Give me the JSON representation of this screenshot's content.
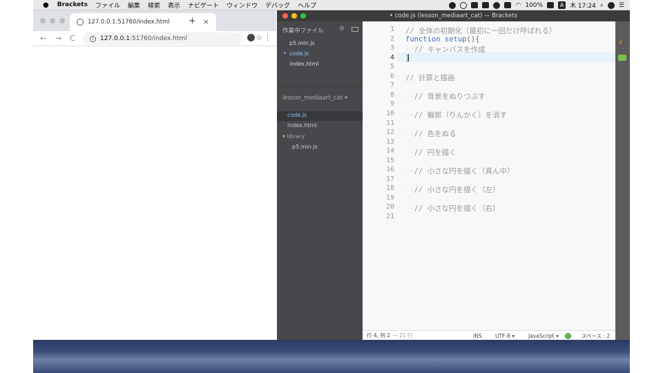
{
  "menubar": {
    "apple": "",
    "app_name": "Brackets",
    "items": [
      "ファイル",
      "編集",
      "検索",
      "表示",
      "ナビゲート",
      "ウィンドウ",
      "デバッグ",
      "ヘルプ"
    ],
    "battery": "100%",
    "clock": "木 17:24",
    "input_method": "A"
  },
  "browser": {
    "tab_title": "127.0.0.1:51760/index.html",
    "tab_close": "×",
    "new_tab": "+",
    "url": "127.0.0.1:51760/index.html",
    "url_host": "127.0.0.1",
    "url_rest": ":51760/index.html",
    "back": "←",
    "forward": "→",
    "reload": "C",
    "star": "☆",
    "kebab": "⋮"
  },
  "brackets": {
    "window_title": "• code.js (lesson_mediaart_cat) — Brackets",
    "working_files_header": "作業中ファイル",
    "working_files": [
      {
        "name": "p5.min.js",
        "active": false
      },
      {
        "name": "code.js",
        "active": true
      },
      {
        "name": "index.html",
        "active": false
      }
    ],
    "project_name": "lesson_mediaart_cat ▾",
    "project_files": [
      {
        "name": "code.js",
        "selected": true
      },
      {
        "name": "index.html",
        "selected": false
      },
      {
        "name": "▾ library",
        "selected": false
      },
      {
        "name": "p5.min.js",
        "selected": false
      }
    ],
    "code_lines": [
      "// 全体の初期化（最初に一回だけ呼ばれる）",
      "function setup(){",
      "  // キャンバスを作成",
      "}",
      "",
      "// 計算と描画",
      "",
      "  // 背景をぬりつぶす",
      "",
      "  // 輪郭（りんかく）を消す",
      "",
      "  // 色をぬる",
      "",
      "  // 円を描く",
      "",
      "  // 小さな円を描く（真ん中）",
      "",
      "  // 小さな円を描く（左）",
      "",
      "  // 小さな円を描く（右）",
      ""
    ],
    "line_numbers": [
      "1",
      "2",
      "3",
      "4",
      "5",
      "6",
      "7",
      "8",
      "9",
      "10",
      "11",
      "12",
      "13",
      "14",
      "15",
      "16",
      "17",
      "18",
      "19",
      "20",
      "21"
    ],
    "current_line": 4,
    "status": {
      "position": "行 4, 列 2",
      "line_count": "— 21 行",
      "mode": "INS",
      "encoding": "UTF-8 ▾",
      "language": "JavaScript ▾",
      "indent": "スペース : 2"
    }
  }
}
